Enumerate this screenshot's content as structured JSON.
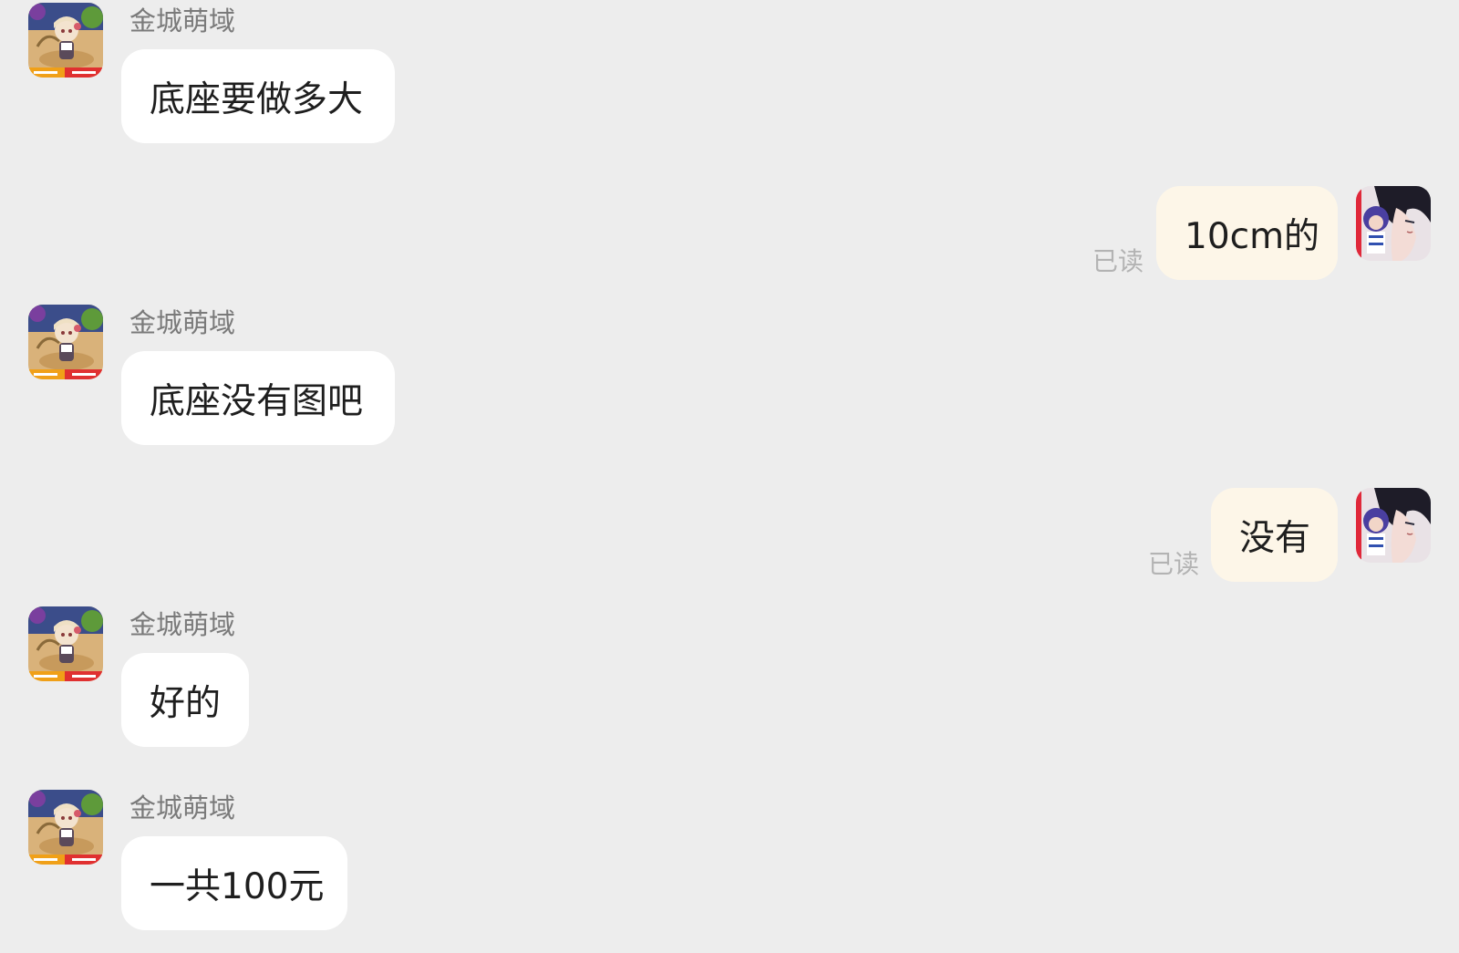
{
  "colors": {
    "background": "#ededed",
    "incoming_bubble": "#ffffff",
    "outgoing_bubble": "#fdf6e8",
    "sender_name": "#7a7a7a",
    "read_status": "#b3b3b3"
  },
  "messages": [
    {
      "direction": "incoming",
      "sender": "金城萌域",
      "text": "底座要做多大",
      "avatar": "seller-avatar"
    },
    {
      "direction": "outgoing",
      "text": "10cm的",
      "status": "已读",
      "avatar": "user-avatar"
    },
    {
      "direction": "incoming",
      "sender": "金城萌域",
      "text": "底座没有图吧",
      "avatar": "seller-avatar"
    },
    {
      "direction": "outgoing",
      "text": "没有",
      "status": "已读",
      "avatar": "user-avatar"
    },
    {
      "direction": "incoming",
      "sender": "金城萌域",
      "text": "好的",
      "avatar": "seller-avatar"
    },
    {
      "direction": "incoming",
      "sender": "金城萌域",
      "text": "一共100元",
      "avatar": "seller-avatar"
    }
  ]
}
